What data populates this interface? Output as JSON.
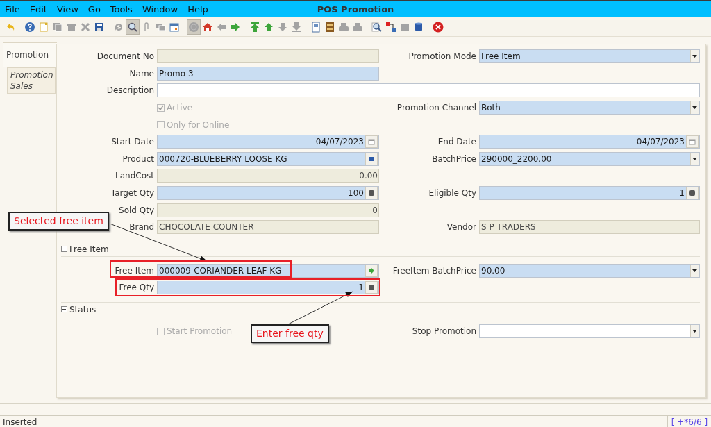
{
  "window": {
    "title": "POS Promotion"
  },
  "menu": [
    "File",
    "Edit",
    "View",
    "Go",
    "Tools",
    "Window",
    "Help"
  ],
  "toolbar": [
    {
      "pressed": false,
      "disabled": false
    },
    {
      "pressed": false,
      "disabled": false
    },
    {
      "pressed": false,
      "disabled": false
    },
    {
      "pressed": false,
      "disabled": true
    },
    {
      "pressed": false,
      "disabled": true
    },
    {
      "pressed": false,
      "disabled": true
    },
    {
      "pressed": false,
      "disabled": false
    },
    {
      "pressed": false,
      "disabled": true
    },
    {
      "pressed": true,
      "disabled": false
    },
    {
      "pressed": false,
      "disabled": true
    },
    {
      "pressed": false,
      "disabled": true
    },
    {
      "pressed": false,
      "disabled": false
    },
    {
      "pressed": true,
      "disabled": true
    },
    {
      "pressed": false,
      "disabled": false
    },
    {
      "pressed": false,
      "disabled": true
    },
    {
      "pressed": false,
      "disabled": false
    },
    {
      "pressed": false,
      "disabled": false
    },
    {
      "pressed": false,
      "disabled": false
    },
    {
      "pressed": false,
      "disabled": true
    },
    {
      "pressed": false,
      "disabled": true
    },
    {
      "pressed": false,
      "disabled": false
    },
    {
      "pressed": false,
      "disabled": false
    },
    {
      "pressed": false,
      "disabled": true
    },
    {
      "pressed": false,
      "disabled": true
    },
    {
      "pressed": false,
      "disabled": false
    },
    {
      "pressed": false,
      "disabled": false
    },
    {
      "pressed": false,
      "disabled": true
    },
    {
      "pressed": false,
      "disabled": false
    },
    {
      "pressed": false,
      "disabled": false
    }
  ],
  "tabs": [
    {
      "label": "Promotion",
      "selected": true
    },
    {
      "label": "Promotion Sales",
      "selected": false
    }
  ],
  "rows": [
    {
      "left": {
        "label": "Document No",
        "kind": "text",
        "mandatory": false,
        "read_only": true
      },
      "right": {
        "label": "Promotion Mode",
        "kind": "combo",
        "mandatory": true,
        "read_only": false,
        "value": "Free Item"
      }
    },
    {
      "left": {
        "label": "Name",
        "kind": "text",
        "mandatory": true,
        "read_only": false,
        "value": "Promo 3"
      }
    },
    {
      "full": {
        "label": "Description",
        "kind": "text",
        "mandatory": false,
        "read_only": false
      }
    },
    {
      "left": {
        "label": "Active",
        "kind": "checkbox",
        "checked": true,
        "disabled": true
      },
      "right": {
        "label": "Promotion Channel",
        "kind": "combo",
        "mandatory": true,
        "read_only": false,
        "value": "Both"
      }
    },
    {
      "left": {
        "label": "Only for Online",
        "kind": "checkbox",
        "checked": false,
        "disabled": true
      }
    },
    {
      "left": {
        "label": "Start Date",
        "kind": "date",
        "mandatory": true,
        "read_only": false,
        "value": "04/07/2023"
      },
      "right": {
        "label": "End Date",
        "kind": "date",
        "mandatory": true,
        "read_only": false,
        "value": "04/07/2023"
      }
    },
    {
      "left": {
        "label": "Product",
        "kind": "search",
        "mandatory": true,
        "read_only": false,
        "value": "000720-BLUEBERRY LOOSE KG"
      },
      "right": {
        "label": "BatchPrice",
        "kind": "combo",
        "mandatory": true,
        "read_only": false,
        "value": "290000_2200.00"
      }
    },
    {
      "left": {
        "label": "LandCost",
        "kind": "amount",
        "mandatory": false,
        "read_only": true,
        "value": "0.00"
      }
    },
    {
      "left": {
        "label": "Target Qty",
        "kind": "number",
        "mandatory": true,
        "read_only": false,
        "value": "100"
      },
      "right": {
        "label": "Eligible Qty",
        "kind": "number",
        "mandatory": true,
        "read_only": false,
        "value": "1"
      }
    },
    {
      "left": {
        "label": "Sold Qty",
        "kind": "amount",
        "mandatory": false,
        "read_only": true,
        "value": "0"
      }
    },
    {
      "left": {
        "label": "Brand",
        "kind": "text",
        "mandatory": false,
        "read_only": true,
        "value": "CHOCOLATE COUNTER"
      },
      "right": {
        "label": "Vendor",
        "kind": "text",
        "mandatory": false,
        "read_only": true,
        "value": "S P TRADERS"
      }
    }
  ],
  "groups": [
    {
      "title": "Free Item",
      "expanded": true,
      "rows": [
        {
          "left": {
            "label": "Free Item",
            "kind": "lookup",
            "mandatory": true,
            "read_only": false,
            "value": "000009-CORIANDER LEAF KG"
          },
          "right": {
            "label": "FreeItem BatchPrice",
            "kind": "combo",
            "mandatory": true,
            "read_only": false,
            "value": "90.00"
          }
        },
        {
          "left": {
            "label": "Free Qty",
            "kind": "number",
            "mandatory": true,
            "read_only": false,
            "value": "1"
          }
        }
      ]
    },
    {
      "title": "Status",
      "expanded": true,
      "rows": [
        {
          "left": {
            "label": "Start Promotion",
            "kind": "checkbox",
            "checked": false,
            "disabled": true
          },
          "right": {
            "label": "Stop Promotion",
            "kind": "combo",
            "mandatory": false,
            "read_only": false
          }
        }
      ]
    }
  ],
  "callouts": [
    {
      "text": "Selected free item"
    },
    {
      "text": "Enter free qty"
    }
  ],
  "status_bar": {
    "message": "Inserted",
    "record": "[ +*6/6 ]"
  }
}
